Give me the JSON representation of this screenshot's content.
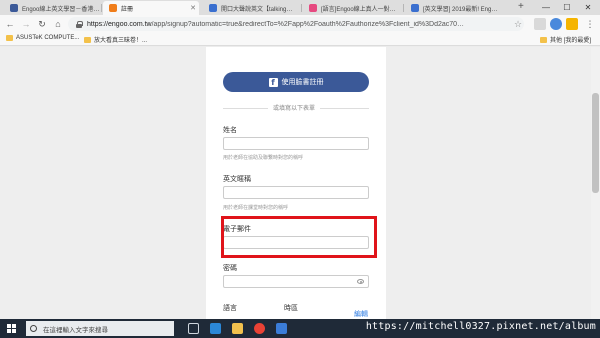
{
  "browser": {
    "tabs": [
      {
        "label": "Engoo線上英文學習－香港…",
        "color": "#3b5998",
        "active": false
      },
      {
        "label": "註冊",
        "color": "#f07d1a",
        "active": true
      },
      {
        "label": "開口大聲說英文【talking…",
        "color": "#3a6fcf",
        "active": false
      },
      {
        "label": "[語言]Engoo線上真人一對…",
        "color": "#e64980",
        "active": false
      },
      {
        "label": "[英文學習] 2019最新! Eng…",
        "color": "#3a6fcf",
        "active": false
      }
    ],
    "new_tab_symbol": "+",
    "window_controls": {
      "minimize": "—",
      "maximize": "☐",
      "close": "✕"
    },
    "url_host": "https://engoo.com.tw",
    "url_path": "/app/signup?automatic=true&redirectTo=%2Fapp%2Foauth%2Fauthorize%3Fclient_id%3Dd2ac70…",
    "bookmarks": [
      "ASUSTeK COMPUTE...",
      "放大看真三昧卷！..."
    ],
    "other_bookmarks": "其他 [我的最愛]"
  },
  "form": {
    "facebook_button": "使用臉書註冊",
    "or_divider": "或填寫以下表單",
    "name_label": "姓名",
    "name_hint": "用於老師在協助及聯繫時對您的稱呼",
    "english_nick_label": "英文暱稱",
    "english_nick_hint": "用於老師在課堂時對您的稱呼",
    "email_label": "電子郵件",
    "password_label": "密碼",
    "language_label": "語言",
    "timezone_label": "時區",
    "edit_link": "編輯"
  },
  "taskbar": {
    "search_placeholder": "在這裡輸入文字來搜尋",
    "watermark": "https://mitchell0327.pixnet.net/album"
  },
  "colors": {
    "facebook": "#3b5998",
    "highlight": "#e0141a",
    "taskbar": "#1f2a38",
    "link": "#2a7ae2"
  }
}
